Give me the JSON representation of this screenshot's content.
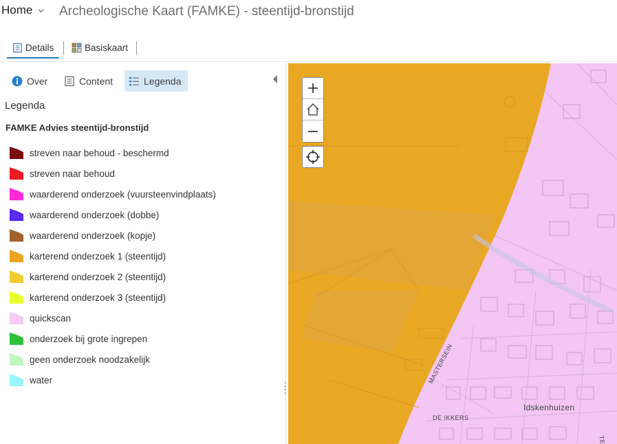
{
  "header": {
    "home_label": "Home",
    "title": "Archeologische Kaart (FAMKE) - steentijd-bronstijd"
  },
  "toolbar": {
    "details_label": "Details",
    "basiskaart_label": "Basiskaart"
  },
  "panel": {
    "tabs": [
      {
        "label": "Over",
        "icon": "info-icon"
      },
      {
        "label": "Content",
        "icon": "content-icon"
      },
      {
        "label": "Legenda",
        "icon": "legend-list-icon",
        "active": true
      }
    ],
    "title": "Legenda",
    "layer_title": "FAMKE Advies steentijd-bronstijd",
    "legend": [
      {
        "label": "streven naar behoud - beschermd",
        "color": "#7b0c0c"
      },
      {
        "label": "streven naar behoud",
        "color": "#ee1d24"
      },
      {
        "label": "waarderend onderzoek (vuursteenvindplaats)",
        "color": "#ff2bd9"
      },
      {
        "label": "waarderend onderzoek (dobbe)",
        "color": "#5a2bf0"
      },
      {
        "label": "waarderend onderzoek (kopje)",
        "color": "#a0622d"
      },
      {
        "label": "karterend onderzoek 1 (steentijd)",
        "color": "#eaa623"
      },
      {
        "label": "karterend onderzoek 2 (steentijd)",
        "color": "#f0cc2e"
      },
      {
        "label": "karterend onderzoek 3 (steentijd)",
        "color": "#e9ff2d"
      },
      {
        "label": "quickscan",
        "color": "#f6c9f6"
      },
      {
        "label": "onderzoek bij grote ingrepen",
        "color": "#2fc13a"
      },
      {
        "label": "geen onderzoek noodzakelijk",
        "color": "#bff7bf"
      },
      {
        "label": "water",
        "color": "#97f6fb"
      }
    ]
  },
  "map": {
    "labels": {
      "place": "Idskenhuizen",
      "road1": "MASTERSEIN",
      "road2": "DE IKKERS",
      "road3": "TERSY"
    },
    "controls": {
      "zoom_in": "zoom-in-icon",
      "home": "home-extent-icon",
      "zoom_out": "zoom-out-icon",
      "locate": "locate-icon"
    }
  }
}
